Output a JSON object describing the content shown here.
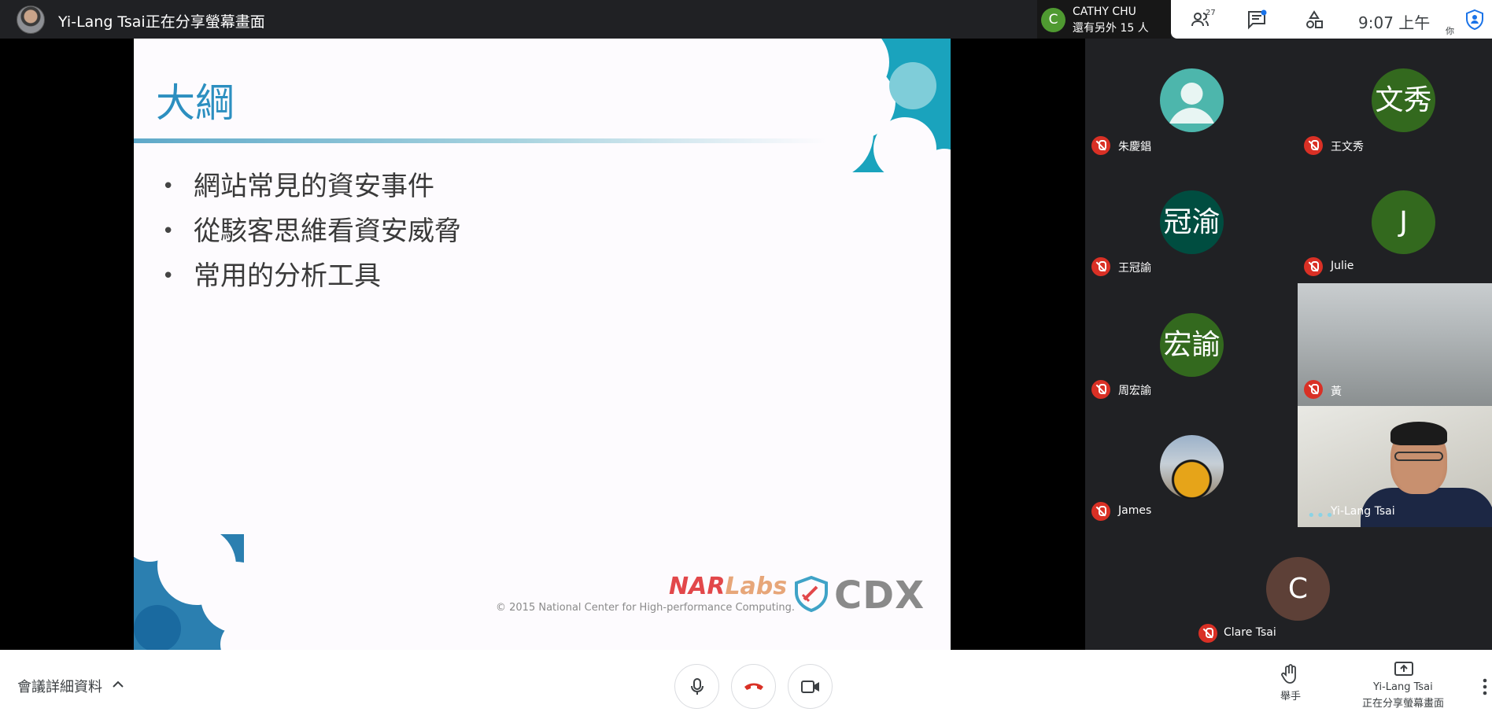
{
  "top_bar": {
    "presenter_title": "Yi-Lang Tsai正在分享螢幕畫面",
    "sharer_initial": "C",
    "sharer_name": "CATHY CHU",
    "sharer_more": "還有另外 15 人",
    "people_count": "27",
    "clock": "9:07 上午",
    "you_label": "你"
  },
  "slide": {
    "title": "大綱",
    "bullets": [
      "網站常見的資安事件",
      "從駭客思維看資安威脅",
      "常用的分析工具"
    ],
    "copyright": "© 2015 National Center for High-performance Computing.",
    "logo_nar": "NAR",
    "logo_labs": "Labs",
    "logo_cdx": "CDX"
  },
  "participants": [
    {
      "name": "朱慶錩",
      "initial": "",
      "avatar_color": "#4db6ac"
    },
    {
      "name": "王文秀",
      "initial": "文秀",
      "avatar_color": "#33691e"
    },
    {
      "name": "王冠諭",
      "initial": "冠渝",
      "avatar_color": "#004d40"
    },
    {
      "name": "Julie",
      "initial": "J",
      "avatar_color": "#33691e"
    },
    {
      "name": "周宏諭",
      "initial": "宏諭",
      "avatar_color": "#33691e"
    },
    {
      "name": "黃",
      "initial": "",
      "avatar_color": ""
    },
    {
      "name": "James",
      "initial": "",
      "avatar_color": ""
    },
    {
      "name": "Yi-Lang Tsai",
      "initial": "",
      "avatar_color": ""
    },
    {
      "name": "Clare Tsai",
      "initial": "C",
      "avatar_color": "#5d4037"
    }
  ],
  "bottom_bar": {
    "details": "會議詳細資料",
    "raise_hand": "舉手",
    "presenting_name": "Yi-Lang Tsai",
    "presenting_status": "正在分享螢幕畫面"
  },
  "colors": {
    "end_call": "#d93025",
    "mic_muted": "#d93025",
    "slide_title": "#2c8fc0"
  }
}
